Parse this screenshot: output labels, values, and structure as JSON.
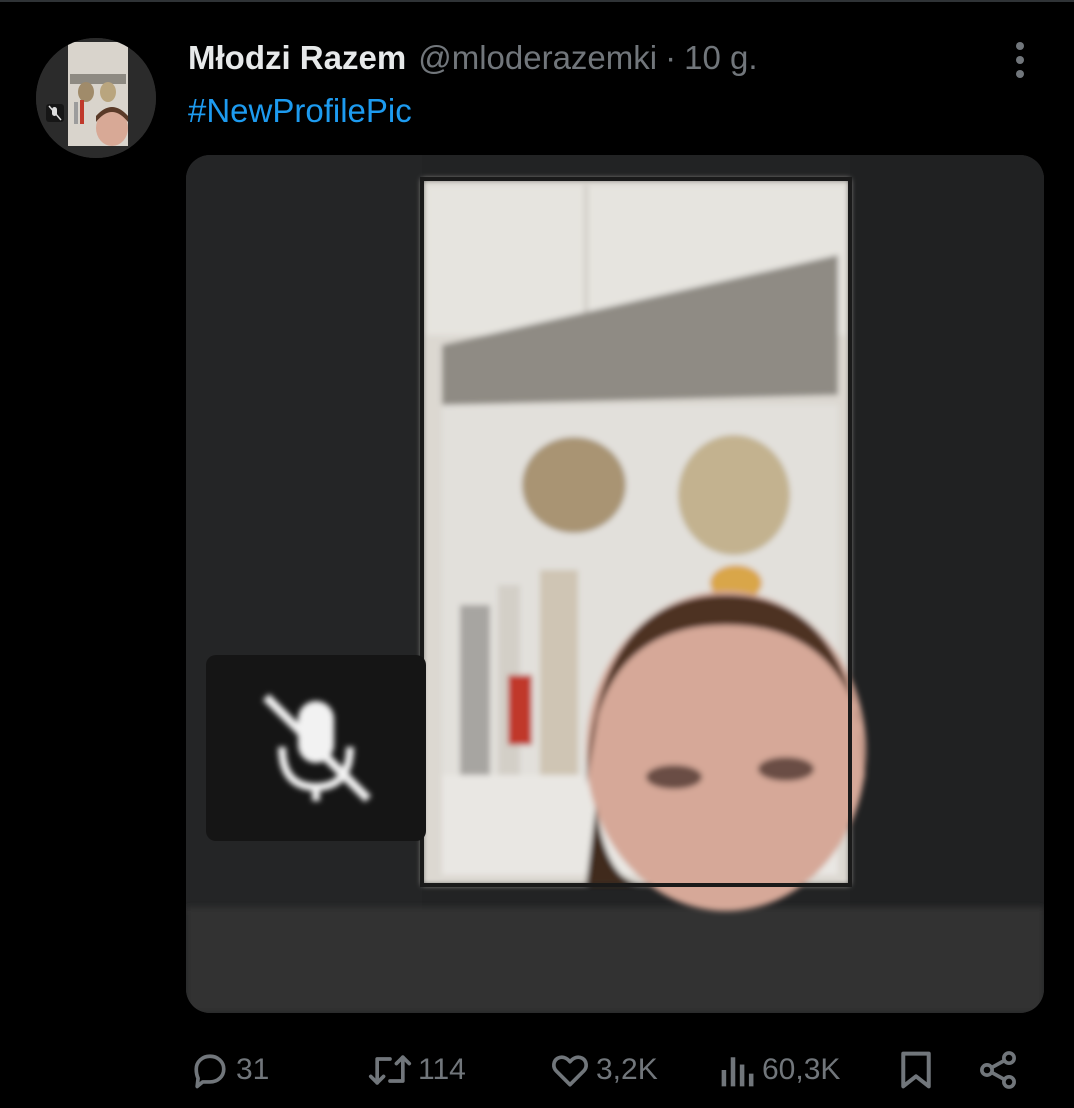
{
  "tweet": {
    "author": {
      "display_name": "Młodzi Razem",
      "handle": "@mloderazemki",
      "separator": "·",
      "timestamp": "10 g."
    },
    "text": "#NewProfilePic",
    "media": {
      "description_icon": "mic-muted-icon"
    },
    "actions": {
      "reply": {
        "icon": "reply-icon",
        "count": "31"
      },
      "retweet": {
        "icon": "retweet-icon",
        "count": "114"
      },
      "like": {
        "icon": "heart-icon",
        "count": "3,2K"
      },
      "views": {
        "icon": "views-chart-icon",
        "count": "60,3K"
      },
      "bookmark": {
        "icon": "bookmark-icon"
      },
      "share": {
        "icon": "share-icon"
      }
    }
  },
  "colors": {
    "background": "#000000",
    "text_primary": "#e7e9ea",
    "text_secondary": "#71767b",
    "accent": "#1d9bf0"
  }
}
